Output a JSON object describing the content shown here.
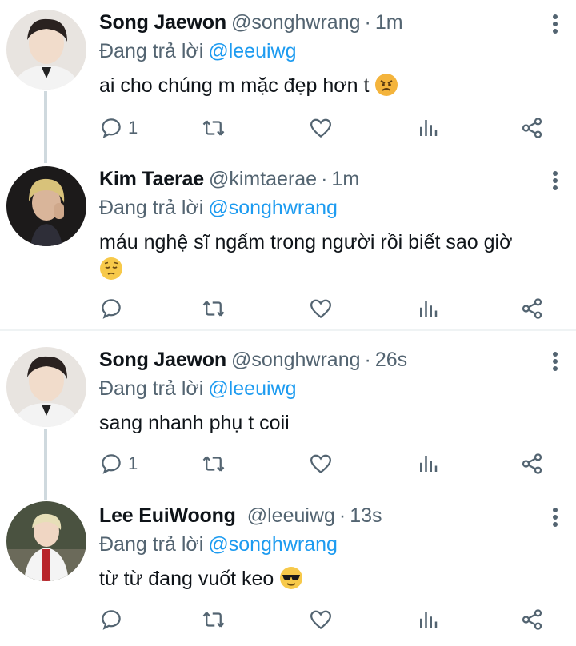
{
  "reply_prefix": "Đang trả lời",
  "dot": "·",
  "tweets": [
    {
      "name": "Song Jaewon",
      "handle": "@songhwrang",
      "time": "1m",
      "reply_to": "@leeuiwg",
      "text": "ai cho chúng m mặc đẹp hơn t",
      "emoji": "angry-face",
      "reply_count": "1"
    },
    {
      "name": "Kim Taerae",
      "handle": "@kimtaerae",
      "time": "1m",
      "reply_to": "@songhwrang",
      "text": "máu nghệ sĩ ngấm trong người rồi biết sao giờ",
      "emoji": "pensive-face",
      "reply_count": ""
    },
    {
      "name": "Song Jaewon",
      "handle": "@songhwrang",
      "time": "26s",
      "reply_to": "@leeuiwg",
      "text": "sang nhanh phụ t coii",
      "emoji": "",
      "reply_count": "1"
    },
    {
      "name": "Lee EuiWoong",
      "handle": "@leeuiwg",
      "time": "13s",
      "reply_to": "@songhwrang",
      "text": "từ từ đang vuốt keo",
      "emoji": "sunglasses-face",
      "reply_count": ""
    }
  ],
  "colors": {
    "accent": "#1d9bf0",
    "secondary_text": "#536471",
    "divider": "#eff3f4"
  },
  "icons": [
    "reply-icon",
    "retweet-icon",
    "like-icon",
    "analytics-icon",
    "share-icon",
    "more-options-icon"
  ]
}
